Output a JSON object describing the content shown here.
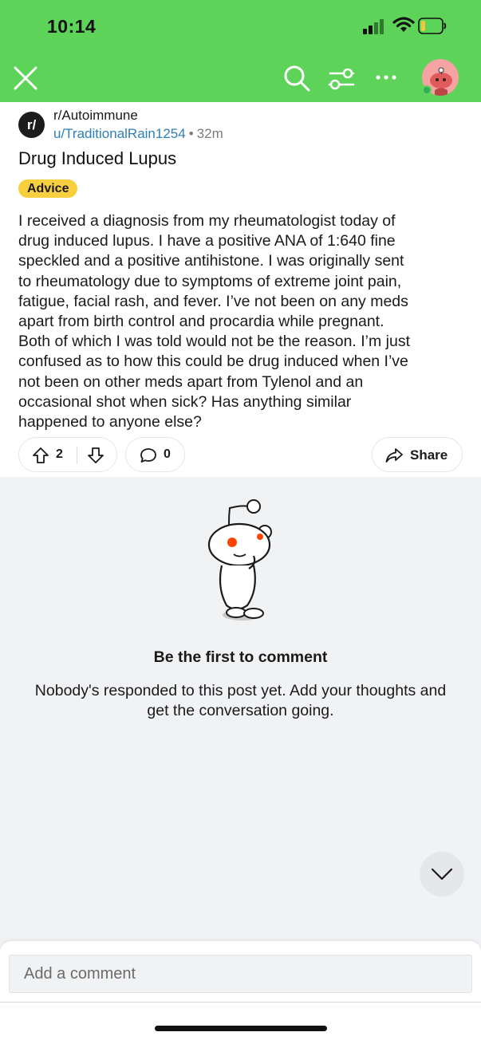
{
  "status_bar": {
    "time": "10:14",
    "signal_icon": "cellular-signal-icon",
    "wifi_icon": "wifi-icon",
    "battery_icon": "battery-icon"
  },
  "header": {
    "background": "#5dd35a",
    "close_icon": "close-icon",
    "search_icon": "search-icon",
    "filter_icon": "sort-filter-icon",
    "more_icon": "more-options-icon"
  },
  "post": {
    "subreddit": "r/Autoimmune",
    "subreddit_icon_text": "r/",
    "author": "u/TraditionalRain1254",
    "separator": "•",
    "time": "32m",
    "title": "Drug Induced Lupus",
    "flair": "Advice",
    "flair_color": "#f8d03f",
    "body_lines": [
      "I received a diagnosis from my rheumatologist today of",
      "drug induced lupus. I have a positive ANA of 1:640 fine",
      "speckled and a positive antihistone. I was originally sent",
      "to rheumatology due to symptoms of extreme joint pain,",
      "fatigue, facial rash, and fever. I’ve not been on any meds",
      "apart from birth control and procardia while pregnant.",
      "Both of which I was told would not be the reason. I’m just",
      "confused as to how this could be drug induced when I’ve",
      "not been on other meds apart from Tylenol and an",
      "occasional shot when sick? Has anything similar",
      "happened to anyone else?"
    ],
    "vote_count": "2",
    "comment_count": "0",
    "share_label": "Share"
  },
  "empty_comments": {
    "title": "Be the first to comment",
    "subtitle": "Nobody's responded to this post yet. Add your thoughts and get the conversation going."
  },
  "composer": {
    "placeholder": "Add a comment"
  }
}
